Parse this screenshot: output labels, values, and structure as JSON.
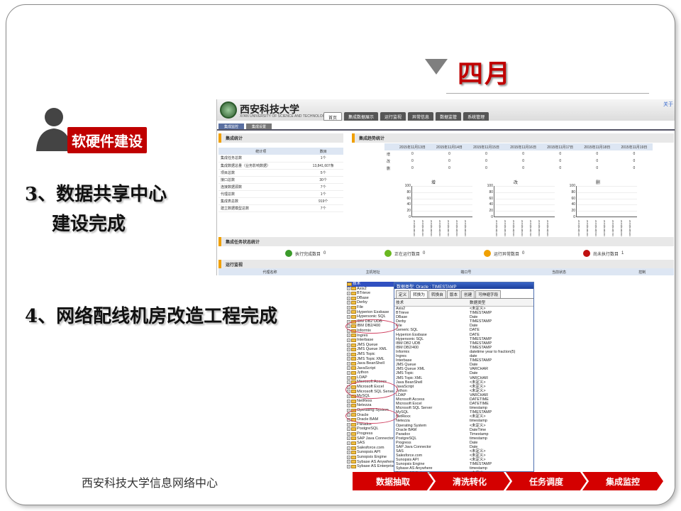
{
  "slide": {
    "month": "四月",
    "tag": "软硬件建设",
    "item3_line1": "3、数据共享中心",
    "item3_line2": "建设完成",
    "item4": "4、网络配线机房改造工程完成",
    "footer": "西安科技大学信息网络中心",
    "accent": "#c00000"
  },
  "portal": {
    "logo_text": "西安科技大学",
    "logo_sub": "XI'AN UNIVERSITY OF SCIENCE AND TECHNOLOGY",
    "corner": "关于",
    "nav": [
      "首页",
      "集成数据展示",
      "运行监视",
      "异常信息",
      "数据监管",
      "系统管理"
    ],
    "subtabs": [
      "集成监控",
      "集成设置"
    ],
    "stat_title": "集成统计",
    "stat_headers": [
      "统计项",
      "数目"
    ],
    "stat_rows": [
      [
        "集成任务总数",
        "1个"
      ],
      [
        "集成数据总量（业务影响数据）",
        "13,841,607条"
      ],
      [
        "项目总数",
        "5个"
      ],
      [
        "接口总数",
        "30个"
      ],
      [
        "连接数据源数",
        "7个"
      ],
      [
        "代理总数",
        "1个"
      ],
      [
        "集成表总数",
        "919个"
      ],
      [
        "建立数据模型总数",
        "7个"
      ]
    ],
    "trend_title": "集成趋势统计",
    "trend_dates": [
      "2015年11月13日",
      "2015年11月14日",
      "2015年11月15日",
      "2015年11月16日",
      "2015年11月17日",
      "2015年11月18日",
      "2015年11月19日"
    ],
    "trend_rows": [
      {
        "label": "增",
        "values": [
          "0",
          "0",
          "0",
          "0",
          "0",
          "0",
          "0"
        ]
      },
      {
        "label": "改",
        "values": [
          "0",
          "0",
          "0",
          "0",
          "0",
          "0",
          "0"
        ]
      },
      {
        "label": "删",
        "values": [
          "0",
          "0",
          "0",
          "0",
          "0",
          "0",
          "0"
        ]
      }
    ],
    "charts": [
      {
        "title": "增",
        "ticks": [
          "100",
          "80",
          "60",
          "40",
          "20",
          "0"
        ]
      },
      {
        "title": "改",
        "ticks": [
          "100",
          "80",
          "60",
          "40",
          "20",
          "0"
        ]
      },
      {
        "title": "删",
        "ticks": [
          "100",
          "80",
          "60",
          "40",
          "20",
          "0"
        ]
      }
    ],
    "task_title": "集成任务状态统计",
    "task_status": [
      {
        "label": "执行完成数目",
        "value": "0",
        "color": "#3a9a2a"
      },
      {
        "label": "正在运行数目",
        "value": "0",
        "color": "#6ab820"
      },
      {
        "label": "运行异常数目",
        "value": "0",
        "color": "#f0a000"
      },
      {
        "label": "尚未执行数目",
        "value": "1",
        "color": "#c01010"
      }
    ],
    "monitor_title": "运行监视",
    "monitor_headers": [
      "代理名称",
      "主机地址",
      "端口号",
      "当前状态",
      "控制"
    ]
  },
  "dbtool": {
    "dialog_title": "数据类型: Oracle : TIMESTAMP",
    "tabs": [
      "定义",
      "转换为",
      "转换自",
      "版本",
      "创建",
      "可伸缩字段"
    ],
    "col_headers": [
      "技术",
      "数据类型"
    ],
    "tree": [
      "技术",
      "Axis2",
      "BTrieve",
      "DBase",
      "Derby",
      "File",
      "Hyperion Essbase",
      "Hypersonic SQL",
      "IBM DB2 UDB",
      "IBM DB2/400",
      "Informix",
      "Ingres",
      "Interbase",
      "JMS Queue",
      "JMS Queue XML",
      "JMS Topic",
      "JMS Topic XML",
      "Java BeanShell",
      "JavaScript",
      "Jython",
      "LDAP",
      "Microsoft Access",
      "Microsoft Excel",
      "Microsoft SQL Server",
      "MySQL",
      "NetRexx",
      "Netezza",
      "Operating System",
      "Oracle",
      "Oracle BAM",
      "Paradox",
      "PostgreSQL",
      "Progress",
      "SAP Java Connector",
      "SAS",
      "Salesforce.com",
      "Sunopsis API",
      "Sunopsis Engine",
      "Sybase AS Anywhere",
      "Sybase AS Enterprise"
    ],
    "rows": [
      [
        "Axis2",
        "<未定义>"
      ],
      [
        "BTrieve",
        "TIMESTAMP"
      ],
      [
        "DBase",
        "Date"
      ],
      [
        "Derby",
        "TIMESTAMP"
      ],
      [
        "File",
        "Date"
      ],
      [
        "Generic SQL",
        "DATE"
      ],
      [
        "Hyperion Essbase",
        "DATE"
      ],
      [
        "Hypersonic SQL",
        "TIMESTAMP"
      ],
      [
        "IBM DB2 UDB",
        "TIMESTAMP"
      ],
      [
        "IBM DB2/400",
        "TIMESTAMP"
      ],
      [
        "Informix",
        "datetime year to fraction(5)"
      ],
      [
        "Ingres",
        "date"
      ],
      [
        "Interbase",
        "TIMESTAMP"
      ],
      [
        "JMS Queue",
        "Date"
      ],
      [
        "JMS Queue XML",
        "VARCHAR"
      ],
      [
        "JMS Topic",
        "Date"
      ],
      [
        "JMS Topic XML",
        "VARCHAR"
      ],
      [
        "Java BeanShell",
        "<未定义>"
      ],
      [
        "JavaScript",
        "<未定义>"
      ],
      [
        "Jython",
        "<未定义>"
      ],
      [
        "LDAP",
        "VARCHAR"
      ],
      [
        "Microsoft Access",
        "DATETIME"
      ],
      [
        "Microsoft Excel",
        "DATETIME"
      ],
      [
        "Microsoft SQL Server",
        "timestamp"
      ],
      [
        "MySQL",
        "TIMESTAMP"
      ],
      [
        "NetRexx",
        "<未定义>"
      ],
      [
        "Netezza",
        "timestamp"
      ],
      [
        "Operating System",
        "<未定义>"
      ],
      [
        "Oracle BAM",
        "DateTime"
      ],
      [
        "Paradox",
        "Timestamp"
      ],
      [
        "PostgreSQL",
        "timestamp"
      ],
      [
        "Progress",
        "Date"
      ],
      [
        "SAP Java Connector",
        "Date"
      ],
      [
        "SAS",
        "<未定义>"
      ],
      [
        "Salesforce.com",
        "<未定义>"
      ],
      [
        "Sunopsis API",
        "<未定义>"
      ],
      [
        "Sunopsis Engine",
        "TIMESTAMP"
      ],
      [
        "Sybase AS Anywhere",
        "timestamp"
      ],
      [
        "Sybase AS Enterprise",
        "<未定义>"
      ]
    ],
    "steps": [
      "数据抽取",
      "清洗转化",
      "任务调度",
      "集成监控"
    ]
  }
}
